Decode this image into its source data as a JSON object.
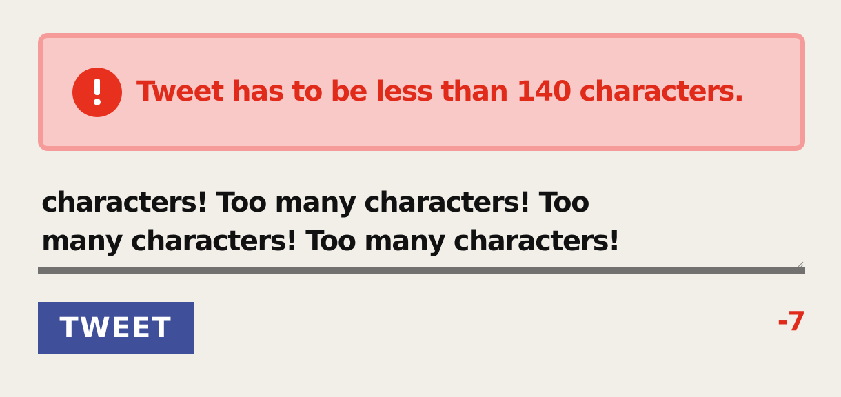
{
  "alert": {
    "icon": "exclamation-circle-icon",
    "message": "Tweet has to be less than 140 characters."
  },
  "composer": {
    "value": "Too many characters! Too many characters! Too many characters! Too many characters! Too many characters!"
  },
  "actions": {
    "tweet_label": "TWEET",
    "counter": "-7"
  },
  "colors": {
    "background": "#f2efe9",
    "alert_background": "#f9c9c8",
    "alert_border": "#f59c9a",
    "error_red": "#e02b1b",
    "button_blue": "#3f4f9a"
  }
}
